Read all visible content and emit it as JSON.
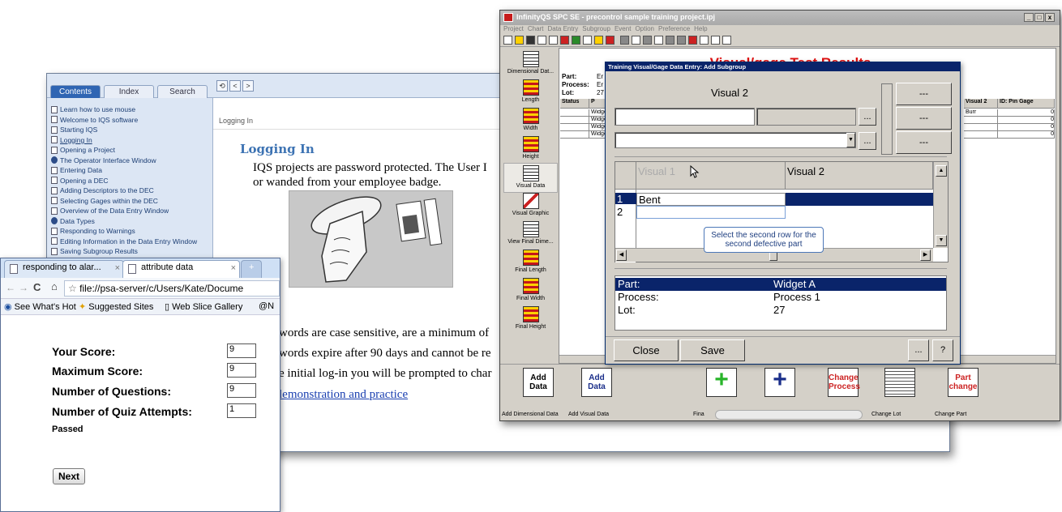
{
  "help": {
    "tabs": [
      "Contents",
      "Index",
      "Search"
    ],
    "toolbar_icons": [
      "sync-icon",
      "back-arrow-icon",
      "forward-arrow-icon"
    ],
    "toc": [
      {
        "label": "Learn how to use mouse",
        "type": "page"
      },
      {
        "label": "Welcome to IQS software",
        "type": "page"
      },
      {
        "label": "Starting IQS",
        "type": "page"
      },
      {
        "label": "Logging In",
        "type": "page",
        "current": true
      },
      {
        "label": "Opening a Project",
        "type": "page"
      },
      {
        "label": "The Operator Interface Window",
        "type": "book"
      },
      {
        "label": "Entering Data",
        "type": "page"
      },
      {
        "label": "Opening a DEC",
        "type": "page"
      },
      {
        "label": "Adding Descriptors to the DEC",
        "type": "page"
      },
      {
        "label": "Selecting Gages within the DEC",
        "type": "page"
      },
      {
        "label": "Overview of the Data Entry Window",
        "type": "page"
      },
      {
        "label": "Data Types",
        "type": "book"
      },
      {
        "label": "Responding to Warnings",
        "type": "page"
      },
      {
        "label": "Editing Information in the Data Entry Window",
        "type": "page"
      },
      {
        "label": "Saving Subgroup Results",
        "type": "page"
      }
    ],
    "breadcrumb": "Logging In",
    "heading": "Logging In",
    "para1_line1": "IQS projects are password protected. The User I",
    "para1_line2": "or wanded from your employee badge.",
    "line_a": "words are case sensitive, are a minimum of",
    "line_b": "words expire after 90 days and cannot be re",
    "line_c": "e initial log-in you will be prompted to char",
    "link": "lemonstration and practice"
  },
  "browser": {
    "tabs": [
      "responding to alar...",
      "attribute data"
    ],
    "address": "file://psa-server/c/Users/Kate/Docume",
    "favorites": [
      "See What's Hot",
      "Suggested Sites",
      "Web Slice Gallery",
      "@N"
    ],
    "quiz": [
      {
        "label": "Your Score:",
        "value": "9"
      },
      {
        "label": "Maximum Score:",
        "value": "9"
      },
      {
        "label": "Number of Questions:",
        "value": "9"
      },
      {
        "label": "Number of Quiz Attempts:",
        "value": "1"
      }
    ],
    "status": "Passed",
    "next": "Next"
  },
  "spc": {
    "title": "InfinityQS SPC SE - precontrol sample training project.ipj",
    "window_buttons": [
      "_",
      "□",
      "x"
    ],
    "menu": [
      "Project",
      "Chart",
      "Data Entry",
      "Subgroup",
      "Event",
      "Option",
      "Preference",
      "Help"
    ],
    "sidebar": [
      {
        "label": "Dimensional Dat...",
        "icon": "grid"
      },
      {
        "label": "Length",
        "icon": "red"
      },
      {
        "label": "Width",
        "icon": "red"
      },
      {
        "label": "Height",
        "icon": "red"
      },
      {
        "label": "Visual Data",
        "icon": "grid",
        "selected": true
      },
      {
        "label": "Visual Graphic",
        "icon": "graph"
      },
      {
        "label": "View Final Dime...",
        "icon": "grid"
      },
      {
        "label": "Final Length",
        "icon": "red"
      },
      {
        "label": "Final Width",
        "icon": "red"
      },
      {
        "label": "Final Height",
        "icon": "red"
      }
    ],
    "heading": "Visual/gage Test Results",
    "info": [
      {
        "label": "Part:",
        "value": "Er"
      },
      {
        "label": "Process:",
        "value": "Er"
      },
      {
        "label": "Lot:",
        "value": "27"
      }
    ],
    "table_headers": [
      "Status",
      "P",
      "Visual 2",
      "ID: Pin Gage"
    ],
    "table_rows": [
      [
        "",
        "Widge",
        "Burr",
        "0"
      ],
      [
        "",
        "Widge",
        "",
        "0"
      ],
      [
        "",
        "Widge",
        "",
        "0"
      ],
      [
        "",
        "Widge",
        "",
        "0"
      ]
    ],
    "bottom": [
      {
        "button": "Add Data",
        "label": "Add Dimensional Data"
      },
      {
        "button": "Add Data",
        "label": "Add Visual Data"
      },
      {
        "button": "",
        "label": "Fina"
      },
      {
        "button": "",
        "label": ""
      },
      {
        "button": "Change Process",
        "label": "cess"
      },
      {
        "button": "",
        "label": "Change Lot"
      },
      {
        "button": "Part change",
        "label": "Change Part"
      }
    ]
  },
  "dialog": {
    "title": "Training Visual/Gage Data Entry: Add Subgroup",
    "field_label": "Visual 2",
    "dash": "---",
    "ellipsis": "...",
    "grid_headers": [
      "Visual 1",
      "Visual 2"
    ],
    "rows": [
      {
        "num": "1",
        "v1": "Bent",
        "v2": ""
      },
      {
        "num": "2",
        "v1": "",
        "v2": ""
      }
    ],
    "tooltip": "Select the second row for the second defective part",
    "info": [
      {
        "label": "Part:",
        "value": "Widget A"
      },
      {
        "label": "Process:",
        "value": "Process 1"
      },
      {
        "label": "Lot:",
        "value": "27"
      }
    ],
    "close": "Close",
    "save": "Save",
    "help": "?"
  }
}
